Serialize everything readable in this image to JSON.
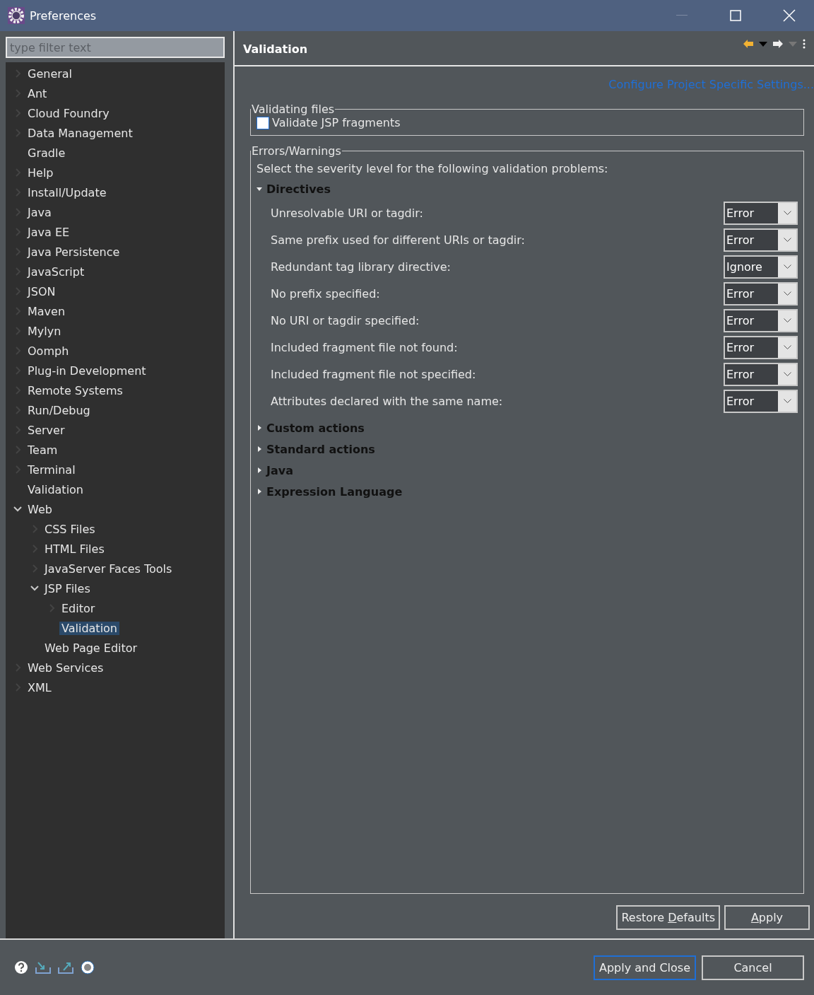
{
  "window": {
    "title": "Preferences"
  },
  "filter": {
    "placeholder": "type filter text"
  },
  "tree": [
    {
      "label": "General",
      "expandable": true,
      "expanded": false,
      "selected": false
    },
    {
      "label": "Ant",
      "expandable": true,
      "expanded": false,
      "selected": false
    },
    {
      "label": "Cloud Foundry",
      "expandable": true,
      "expanded": false,
      "selected": false
    },
    {
      "label": "Data Management",
      "expandable": true,
      "expanded": false,
      "selected": false
    },
    {
      "label": "Gradle",
      "expandable": false,
      "selected": false
    },
    {
      "label": "Help",
      "expandable": true,
      "expanded": false,
      "selected": false
    },
    {
      "label": "Install/Update",
      "expandable": true,
      "expanded": false,
      "selected": false
    },
    {
      "label": "Java",
      "expandable": true,
      "expanded": false,
      "selected": false
    },
    {
      "label": "Java EE",
      "expandable": true,
      "expanded": false,
      "selected": false
    },
    {
      "label": "Java Persistence",
      "expandable": true,
      "expanded": false,
      "selected": false
    },
    {
      "label": "JavaScript",
      "expandable": true,
      "expanded": false,
      "selected": false
    },
    {
      "label": "JSON",
      "expandable": true,
      "expanded": false,
      "selected": false
    },
    {
      "label": "Maven",
      "expandable": true,
      "expanded": false,
      "selected": false
    },
    {
      "label": "Mylyn",
      "expandable": true,
      "expanded": false,
      "selected": false
    },
    {
      "label": "Oomph",
      "expandable": true,
      "expanded": false,
      "selected": false
    },
    {
      "label": "Plug-in Development",
      "expandable": true,
      "expanded": false,
      "selected": false
    },
    {
      "label": "Remote Systems",
      "expandable": true,
      "expanded": false,
      "selected": false
    },
    {
      "label": "Run/Debug",
      "expandable": true,
      "expanded": false,
      "selected": false
    },
    {
      "label": "Server",
      "expandable": true,
      "expanded": false,
      "selected": false
    },
    {
      "label": "Team",
      "expandable": true,
      "expanded": false,
      "selected": false
    },
    {
      "label": "Terminal",
      "expandable": true,
      "expanded": false,
      "selected": false
    },
    {
      "label": "Validation",
      "expandable": false,
      "selected": false
    },
    {
      "label": "Web",
      "expandable": true,
      "expanded": true,
      "selected": false,
      "children": [
        {
          "label": "CSS Files",
          "expandable": true,
          "expanded": false,
          "selected": false
        },
        {
          "label": "HTML Files",
          "expandable": true,
          "expanded": false,
          "selected": false
        },
        {
          "label": "JavaServer Faces Tools",
          "expandable": true,
          "expanded": false,
          "selected": false
        },
        {
          "label": "JSP Files",
          "expandable": true,
          "expanded": true,
          "selected": false,
          "children": [
            {
              "label": "Editor",
              "expandable": true,
              "expanded": false,
              "selected": false
            },
            {
              "label": "Validation",
              "expandable": false,
              "selected": true
            }
          ]
        },
        {
          "label": "Web Page Editor",
          "expandable": false,
          "selected": false
        }
      ]
    },
    {
      "label": "Web Services",
      "expandable": true,
      "expanded": false,
      "selected": false
    },
    {
      "label": "XML",
      "expandable": true,
      "expanded": false,
      "selected": false
    }
  ],
  "page": {
    "title": "Validation",
    "link": "Configure Project Specific Settings...",
    "validating_files": {
      "legend": "Validating files",
      "checkbox": {
        "label": "Validate JSP fragments",
        "checked": false
      }
    },
    "errors_warnings": {
      "legend": "Errors/Warnings",
      "intro": "Select the severity level for the following validation problems:",
      "sections": [
        {
          "title": "Directives",
          "expanded": true,
          "rows": [
            {
              "label": "Unresolvable URI or tagdir:",
              "value": "Error"
            },
            {
              "label": "Same prefix used for different URIs or tagdir:",
              "value": "Error"
            },
            {
              "label": "Redundant tag library directive:",
              "value": "Ignore"
            },
            {
              "label": "No prefix specified:",
              "value": "Error"
            },
            {
              "label": "No URI or tagdir specified:",
              "value": "Error"
            },
            {
              "label": "Included fragment file not found:",
              "value": "Error"
            },
            {
              "label": "Included fragment file not specified:",
              "value": "Error"
            },
            {
              "label": "Attributes declared with the same name:",
              "value": "Error"
            }
          ]
        },
        {
          "title": "Custom actions",
          "expanded": false
        },
        {
          "title": "Standard actions",
          "expanded": false
        },
        {
          "title": "Java",
          "expanded": false
        },
        {
          "title": "Expression Language",
          "expanded": false
        }
      ]
    },
    "buttons": [
      {
        "before": "Restore ",
        "key": "D",
        "after": "efaults"
      },
      {
        "key": "A",
        "after": "pply"
      }
    ]
  },
  "dialog_buttons": [
    {
      "label": "Apply and Close",
      "default": true
    },
    {
      "label": "Cancel",
      "default": false
    }
  ]
}
